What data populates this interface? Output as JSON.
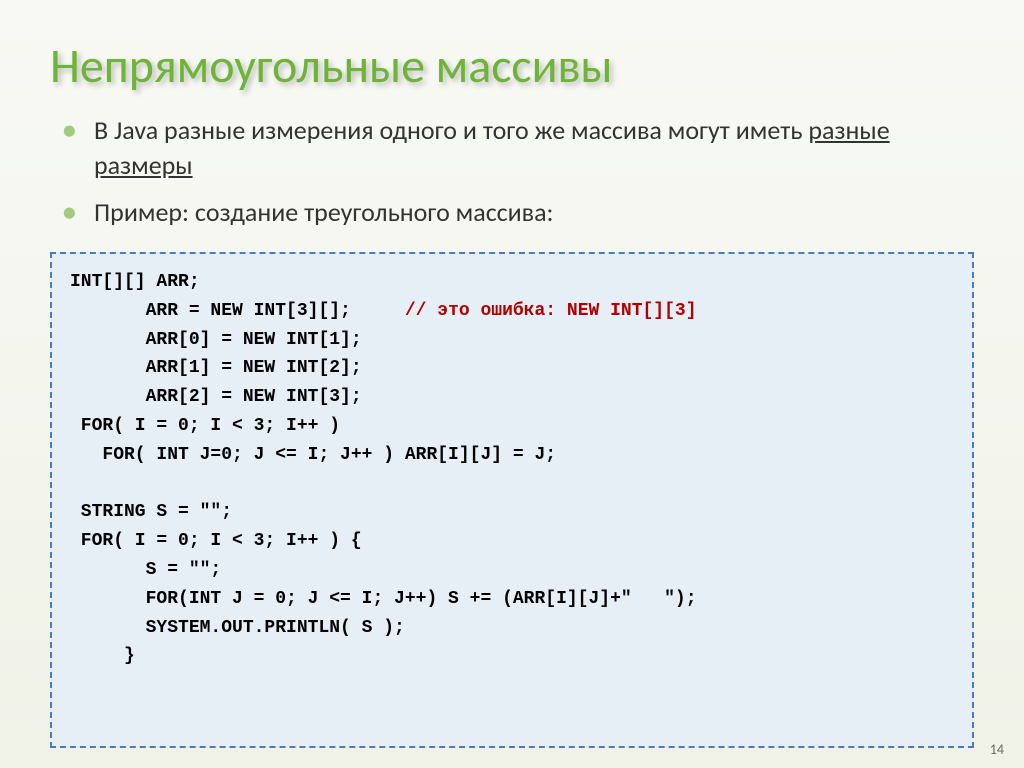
{
  "title": "Непрямоугольные массивы",
  "bullets": [
    {
      "pre": "В Java разные измерения одного и того же массива могут иметь ",
      "underlined": "разные размеры",
      "post": ""
    },
    {
      "pre": "Пример: создание треугольного массива:",
      "underlined": "",
      "post": ""
    }
  ],
  "code": {
    "l1": "INT[][] ARR;",
    "l2": "       ARR = NEW INT[3][];     ",
    "l2_comment": "// это ошибка: NEW INT[][3]",
    "l3": "       ARR[0] = NEW INT[1];",
    "l4": "       ARR[1] = NEW INT[2];",
    "l5": "       ARR[2] = NEW INT[3];",
    "l6": " FOR( I = 0; I < 3; I++ )",
    "l7": "   FOR( INT J=0; J <= I; J++ ) ARR[I][J] = J;",
    "l8": "",
    "l9": " STRING S = \"\";",
    "l10": " FOR( I = 0; I < 3; I++ ) {",
    "l11": "       S = \"\";",
    "l12": "       FOR(INT J = 0; J <= I; J++) S += (ARR[I][J]+\"   \");",
    "l13": "       SYSTEM.OUT.PRINTLN( S );",
    "l14": "     }"
  },
  "page_number": "14"
}
